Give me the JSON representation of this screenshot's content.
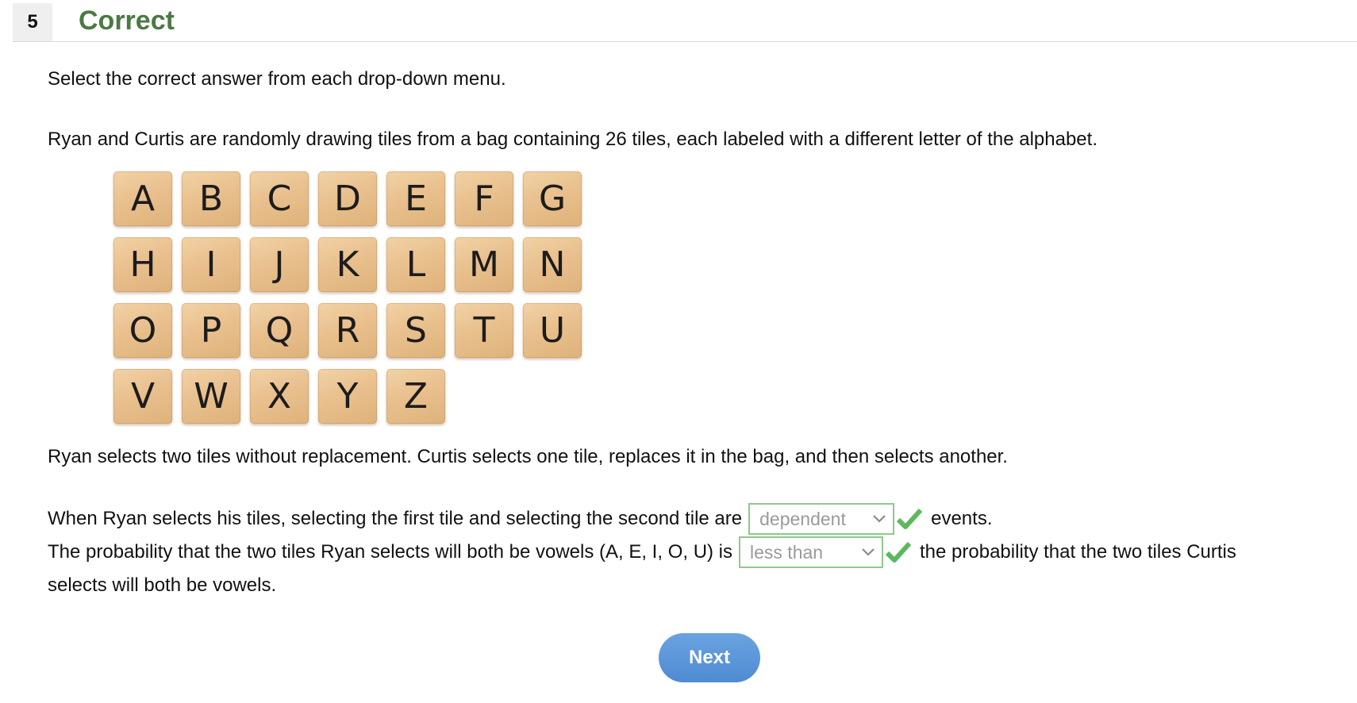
{
  "header": {
    "question_number": "5",
    "status": "Correct"
  },
  "instruction": "Select the correct answer from each drop-down menu.",
  "intro": "Ryan and Curtis are randomly drawing tiles from a bag containing 26 tiles, each labeled with a different letter of the alphabet.",
  "tiles": [
    "A",
    "B",
    "C",
    "D",
    "E",
    "F",
    "G",
    "H",
    "I",
    "J",
    "K",
    "L",
    "M",
    "N",
    "O",
    "P",
    "Q",
    "R",
    "S",
    "T",
    "U",
    "V",
    "W",
    "X",
    "Y",
    "Z"
  ],
  "rule": "Ryan selects two tiles without replacement. Curtis selects one tile, replaces it in the bag, and then selects another.",
  "question1": {
    "before": "When Ryan selects his tiles, selecting the first tile and selecting the second tile are",
    "selected": "dependent",
    "after": "events."
  },
  "question2": {
    "before": "The probability that the two tiles Ryan selects will both be vowels (A, E, I, O, U) is",
    "selected": "less than",
    "after": "the probability that the two tiles Curtis",
    "continuation": "selects will both be vowels."
  },
  "next_label": "Next",
  "colors": {
    "status_green": "#4a7a43",
    "select_border": "#8fc98a",
    "check_green": "#5cb85c",
    "button_blue": "#5a94d8"
  },
  "icons": {
    "check": "check-icon",
    "dropdown": "chevron-down-icon"
  }
}
